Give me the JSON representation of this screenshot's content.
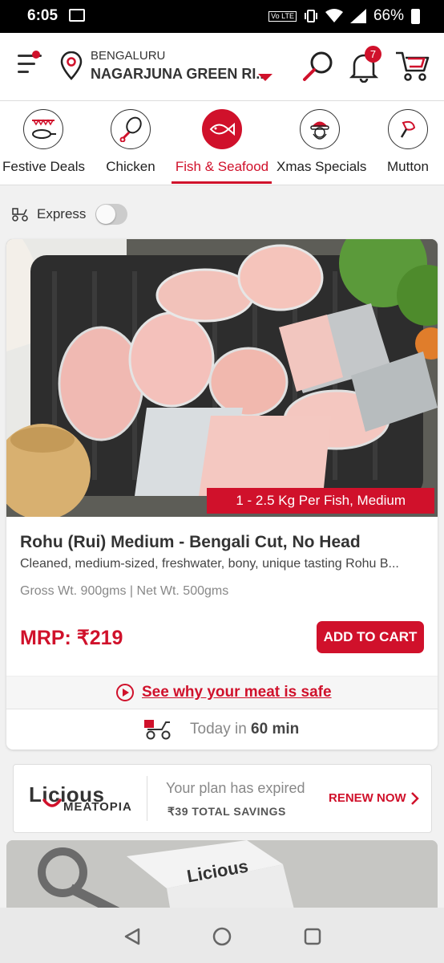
{
  "status": {
    "time": "6:05",
    "volte": "Vo LTE",
    "battery": "66%"
  },
  "header": {
    "city": "BENGALURU",
    "area": "NAGARJUNA GREEN RI...",
    "notification_count": "7",
    "icons": [
      "menu-icon",
      "location-pin-icon",
      "search-icon",
      "bell-icon",
      "cart-icon"
    ]
  },
  "categories": [
    {
      "label": "Festive Deals",
      "icon": "festive-pan-icon"
    },
    {
      "label": "Chicken",
      "icon": "drumstick-icon"
    },
    {
      "label": "Fish & Seafood",
      "icon": "fish-icon",
      "active": true
    },
    {
      "label": "Xmas Specials",
      "icon": "santa-icon"
    },
    {
      "label": "Mutton",
      "icon": "mutton-icon"
    }
  ],
  "express": {
    "label": "Express",
    "enabled": false
  },
  "product": {
    "weight_tag": "1 - 2.5 Kg Per Fish, Medium",
    "name": "Rohu (Rui) Medium - Bengali Cut, No Head",
    "description": "Cleaned, medium-sized, freshwater, bony, unique tasting Rohu B...",
    "weights": "Gross Wt.  900gms  |  Net Wt.  500gms",
    "price": "MRP: ₹219",
    "add_to_cart": "ADD TO CART",
    "safe_link": "See why your meat is safe",
    "delivery_prefix": "Today in ",
    "delivery_time": "60 min"
  },
  "plan": {
    "brand": "Licious",
    "sub_brand": "MEATOPIA",
    "status": "Your plan has expired",
    "savings": "₹39 TOTAL SAVINGS",
    "renew": "RENEW NOW"
  },
  "next_card": {
    "brand": "Licious"
  },
  "colors": {
    "accent": "#d0112b",
    "text": "#333333",
    "muted": "#888888"
  }
}
